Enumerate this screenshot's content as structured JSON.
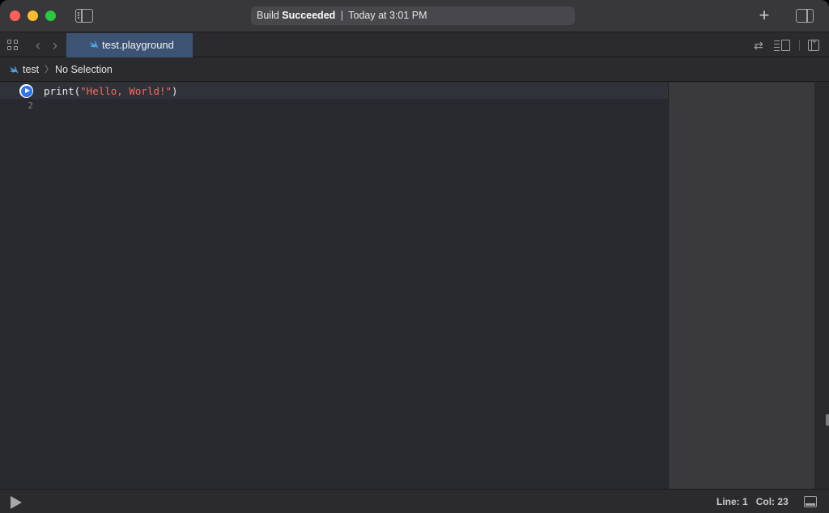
{
  "titlebar": {
    "activity": {
      "prefix": "Build",
      "status": "Succeeded",
      "separator": "|",
      "time": "Today at 3:01 PM"
    },
    "add_icon": "+"
  },
  "tabbar": {
    "back_icon": "‹",
    "forward_icon": "›",
    "active_tab": "test.playground",
    "swap_icon": "⇄"
  },
  "jumpbar": {
    "project": "test",
    "chevron": "〉",
    "selection": "No Selection"
  },
  "editor": {
    "lines": [
      {
        "number": "1",
        "code_func": "print(",
        "code_string": "\"Hello, World!\"",
        "code_close": ")"
      },
      {
        "number": "2"
      }
    ]
  },
  "statusbar": {
    "line_label": "Line:",
    "line_value": "1",
    "col_label": "Col:",
    "col_value": "23"
  },
  "colors": {
    "swift_orange": "#4aa8e8",
    "string_literal": "#fc6a5d",
    "active_tab": "#3d5374",
    "run_button_blue": "#2f74ea"
  }
}
